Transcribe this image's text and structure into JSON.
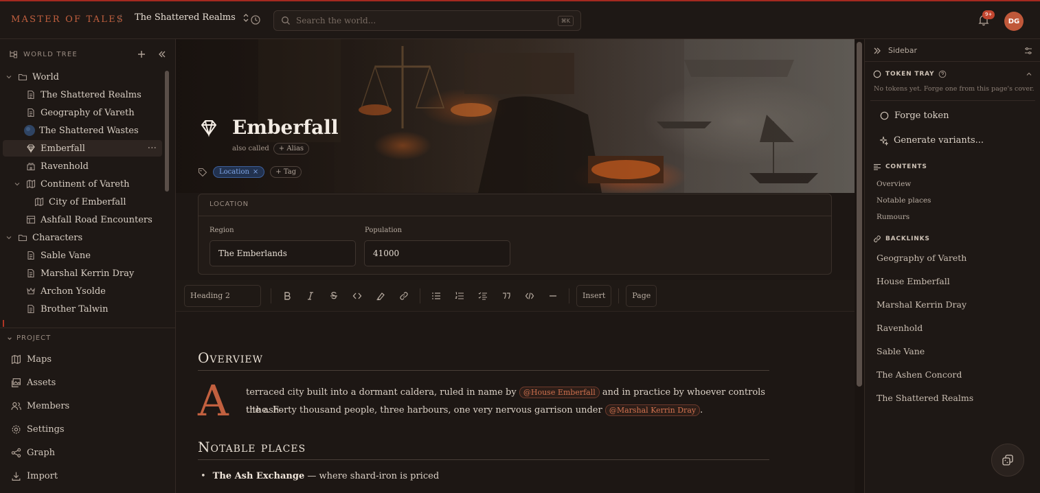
{
  "app": {
    "brand": "MASTER OF TALES",
    "project": "The Shattered Realms"
  },
  "search": {
    "placeholder": "Search the world...",
    "shortcut": "⌘K"
  },
  "notifications": {
    "badge": "9+"
  },
  "user": {
    "initials": "DG"
  },
  "tree": {
    "title": "WORLD TREE",
    "nodes": [
      {
        "label": "World",
        "icon": "folder-icon",
        "expanded": true
      },
      {
        "label": "The Shattered Realms",
        "icon": "document-icon"
      },
      {
        "label": "Geography of Vareth",
        "icon": "document-icon"
      },
      {
        "label": "The Shattered Wastes",
        "icon": "globe-icon"
      },
      {
        "label": "Emberfall",
        "icon": "gem-icon",
        "active": true
      },
      {
        "label": "Ravenhold",
        "icon": "castle-icon"
      },
      {
        "label": "Continent of Vareth",
        "icon": "map-icon",
        "expanded": true
      },
      {
        "label": "City of Emberfall",
        "icon": "map-icon"
      },
      {
        "label": "Ashfall Road Encounters",
        "icon": "table-icon"
      },
      {
        "label": "Characters",
        "icon": "folder-icon",
        "expanded": true
      },
      {
        "label": "Sable Vane",
        "icon": "document-icon"
      },
      {
        "label": "Marshal Kerrin Dray",
        "icon": "document-icon"
      },
      {
        "label": "Archon Ysolde",
        "icon": "crown-icon"
      },
      {
        "label": "Brother Talwin",
        "icon": "document-icon"
      }
    ]
  },
  "project": {
    "title": "PROJECT",
    "items": [
      {
        "label": "Maps",
        "icon": "map-icon"
      },
      {
        "label": "Assets",
        "icon": "images-icon"
      },
      {
        "label": "Members",
        "icon": "users-icon"
      },
      {
        "label": "Settings",
        "icon": "gear-icon"
      },
      {
        "label": "Graph",
        "icon": "graph-icon"
      },
      {
        "label": "Import",
        "icon": "import-icon"
      }
    ]
  },
  "page": {
    "title": "Emberfall",
    "also_called": "also called",
    "alias_button": "+ Alias",
    "tag": "Location",
    "tag_button": "+ Tag"
  },
  "location_card": {
    "title": "LOCATION",
    "region_label": "Region",
    "region_value": "The Emberlands",
    "population_label": "Population",
    "population_value": "41000"
  },
  "toolbar": {
    "heading": "Heading 2",
    "insert": "Insert",
    "page": "Page"
  },
  "doc": {
    "overview_heading": "Overview",
    "dropcap": "A",
    "para_line1_a": "terraced city built into a dormant caldera, ruled in name by",
    "mention1": "@House Emberfall",
    "para_line1_b": "and in practice by whoever controls the ash-",
    "para_line2_a": "tithe. Forty thousand people, three harbours, one very nervous garrison under",
    "mention2": "@Marshal Kerrin Dray",
    "para_line2_b": ".",
    "notable_heading": "Notable places",
    "item1_bold": "The Ash Exchange",
    "item1_rest": "— where shard-iron is priced"
  },
  "right": {
    "title": "Sidebar",
    "token_title": "TOKEN TRAY",
    "token_empty": "No tokens yet. Forge one from this page's cover.",
    "forge": "Forge token",
    "variants": "Generate variants...",
    "contents_title": "CONTENTS",
    "contents": [
      "Overview",
      "Notable places",
      "Rumours"
    ],
    "backlinks_title": "BACKLINKS",
    "backlinks": [
      "Geography of Vareth",
      "House Emberfall",
      "Marshal Kerrin Dray",
      "Ravenhold",
      "Sable Vane",
      "The Ashen Concord",
      "The Shattered Realms"
    ]
  },
  "colors": {
    "accent": "#c2603f",
    "tag_blue": "#7fa6e8",
    "top_border": "#a5291f"
  }
}
